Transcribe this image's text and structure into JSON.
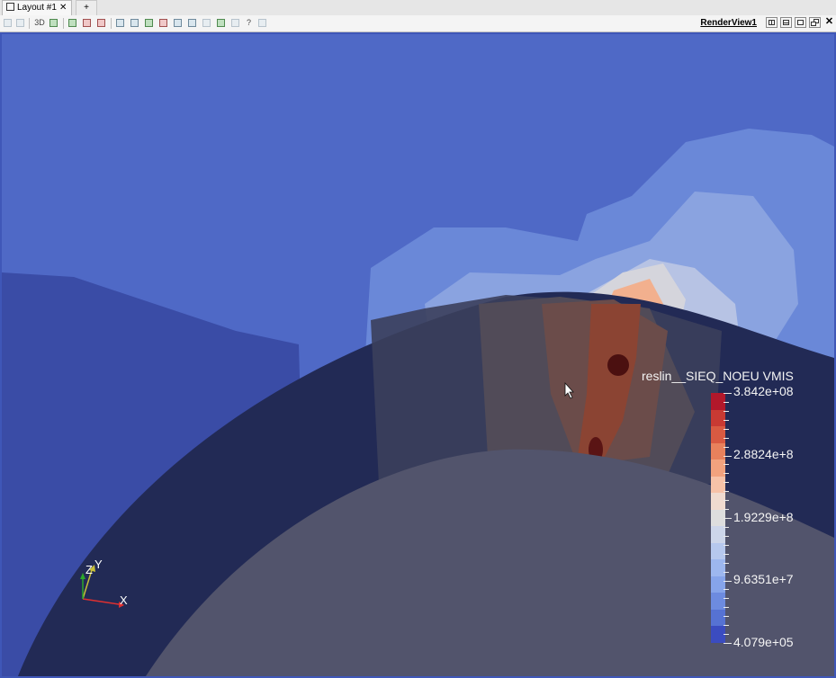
{
  "tabs": {
    "active_label": "Layout #1",
    "close_glyph": "✕",
    "add_label": "+"
  },
  "toolbar": {
    "three_d_label": "3D",
    "help_label": "?",
    "view_name": "RenderView1",
    "close_glyph": "✕",
    "icons": [
      "camera-undo-icon",
      "camera-redo-icon",
      "toggle-3d-icon",
      "reset-camera-icon",
      "zoom-to-data-icon",
      "zoom-to-box-icon",
      "select-cells-icon",
      "select-points-icon",
      "select-cells-frustum-icon",
      "select-points-frustum-icon",
      "select-block-icon",
      "interactive-select-cells-icon",
      "interactive-select-points-icon",
      "grow-selection-icon",
      "shrink-selection-icon",
      "clear-selection-icon",
      "hover-cells-icon",
      "pick-center-icon",
      "help-icon",
      "delete-icon"
    ]
  },
  "render_view": {
    "background_color": "#4f69c6",
    "cursor": "arrow-cursor"
  },
  "legend": {
    "title": "reslin__SIEQ_NOEU VMIS",
    "labels": [
      "3.842e+08",
      "2.8824e+8",
      "1.9229e+8",
      "9.6351e+7",
      "4.079e+05"
    ],
    "range": [
      407900,
      384200000
    ],
    "colormap": "Cool to Warm",
    "color_bands": [
      "#b2182b",
      "#c83a33",
      "#d95a42",
      "#e8815c",
      "#f2a27e",
      "#f7c2a8",
      "#f0dbd0",
      "#dedede",
      "#cdd6ea",
      "#b6c8ee",
      "#9db7ef",
      "#86a4ea",
      "#6d8be0",
      "#5672d3",
      "#3b4cc0"
    ]
  },
  "orientation_axes": {
    "x_label": "X",
    "y_label": "Y",
    "z_label": "Z"
  }
}
